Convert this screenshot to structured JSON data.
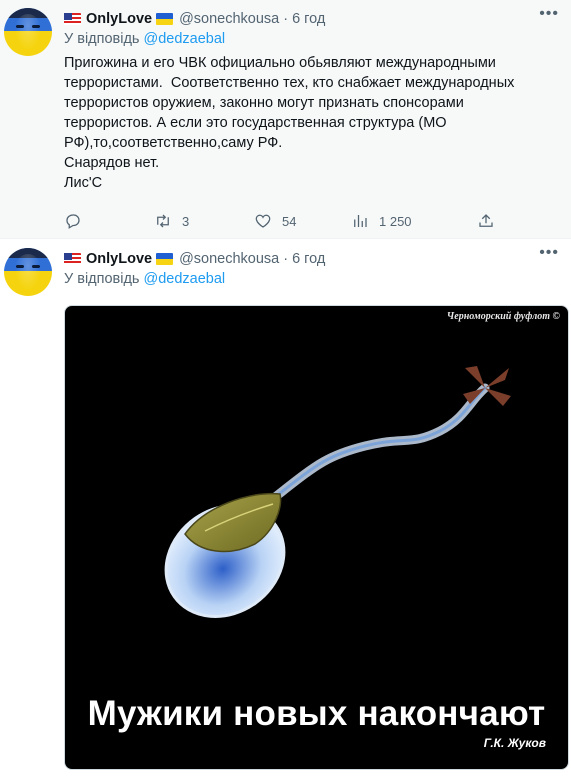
{
  "tweets": [
    {
      "author_name": "OnlyLove",
      "handle": "@sonechkousa",
      "dot": "·",
      "time": "6 год",
      "reply_prefix": "У відповідь",
      "reply_to": "@dedzaebal",
      "text_lines": [
        "Пригожина и его ЧВК официально обьявляют международными",
        "террористами.  Соответственно тех, кто снабжает международных",
        "террористов оружием, законно могут признать спонсорами",
        "террористов. А если это государственная структура (МО",
        "РФ),то,соответственно,саму РФ.",
        "Снарядов нет.",
        "Лис'С"
      ],
      "stats": {
        "replies": "",
        "retweets": "3",
        "likes": "54",
        "views": "1 250"
      }
    },
    {
      "author_name": "OnlyLove",
      "handle": "@sonechkousa",
      "dot": "·",
      "time": "6 год",
      "reply_prefix": "У відповідь",
      "reply_to": "@dedzaebal",
      "image": {
        "watermark": "Черноморский фуфлот ©",
        "caption": "Мужики новых накончают",
        "signature": "Г.К. Жуков"
      }
    }
  ],
  "icons": {
    "more": "more-horizontal-icon",
    "reply": "reply-icon",
    "retweet": "retweet-icon",
    "like": "heart-icon",
    "views": "views-icon",
    "share": "share-icon"
  },
  "colors": {
    "accent": "#1d9bf0",
    "muted": "#536471",
    "highlight_bg": "#f7f9f9"
  }
}
